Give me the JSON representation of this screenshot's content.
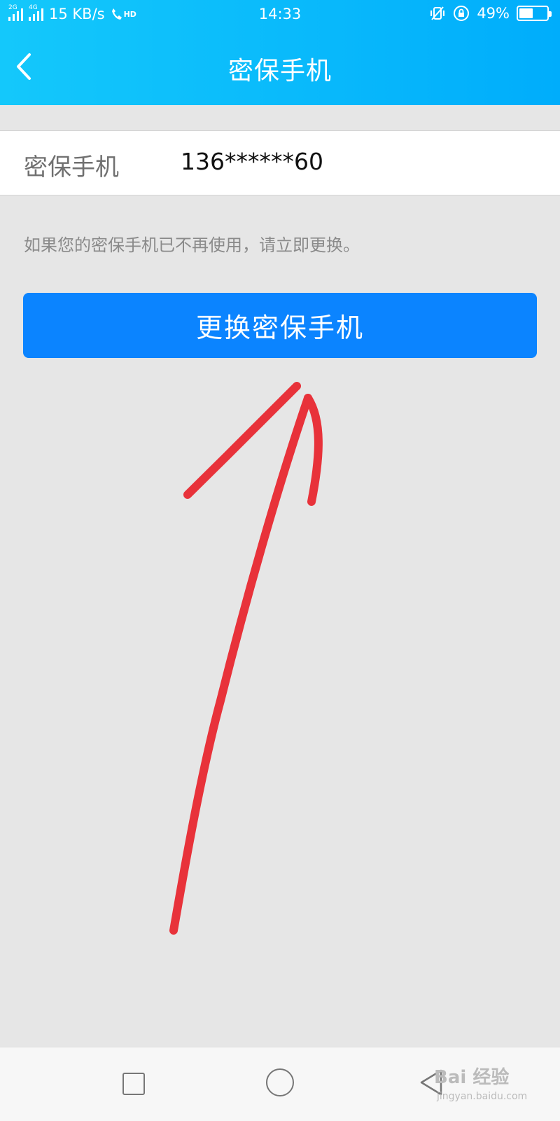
{
  "status_bar": {
    "net_2g": "2G",
    "net_4g": "4G",
    "speed": "15 KB/s",
    "hd": "HD",
    "time": "14:33",
    "battery": "49%",
    "battery_level": 0.49,
    "icons": [
      "signal-icon",
      "call-icon",
      "vibrate-icon",
      "rotation-lock-icon",
      "battery-icon"
    ]
  },
  "header": {
    "title": "密保手机",
    "back_icon": "chevron-left-icon",
    "color_start": "#14c8fb",
    "color_end": "#00adfb"
  },
  "phone_row": {
    "label": "密保手机",
    "value": "136******60"
  },
  "hint": "如果您的密保手机已不再使用，请立即更换。",
  "primary_button": {
    "label": "更换密保手机",
    "color": "#0b84ff"
  },
  "annotation": {
    "type": "hand-drawn-arrow",
    "color": "#e8323a"
  },
  "nav_bar": {
    "icons": [
      "recent-apps-icon",
      "home-icon",
      "back-icon"
    ]
  },
  "watermark": {
    "text": "Bai 经验",
    "sub": "jingyan.baidu.com"
  }
}
